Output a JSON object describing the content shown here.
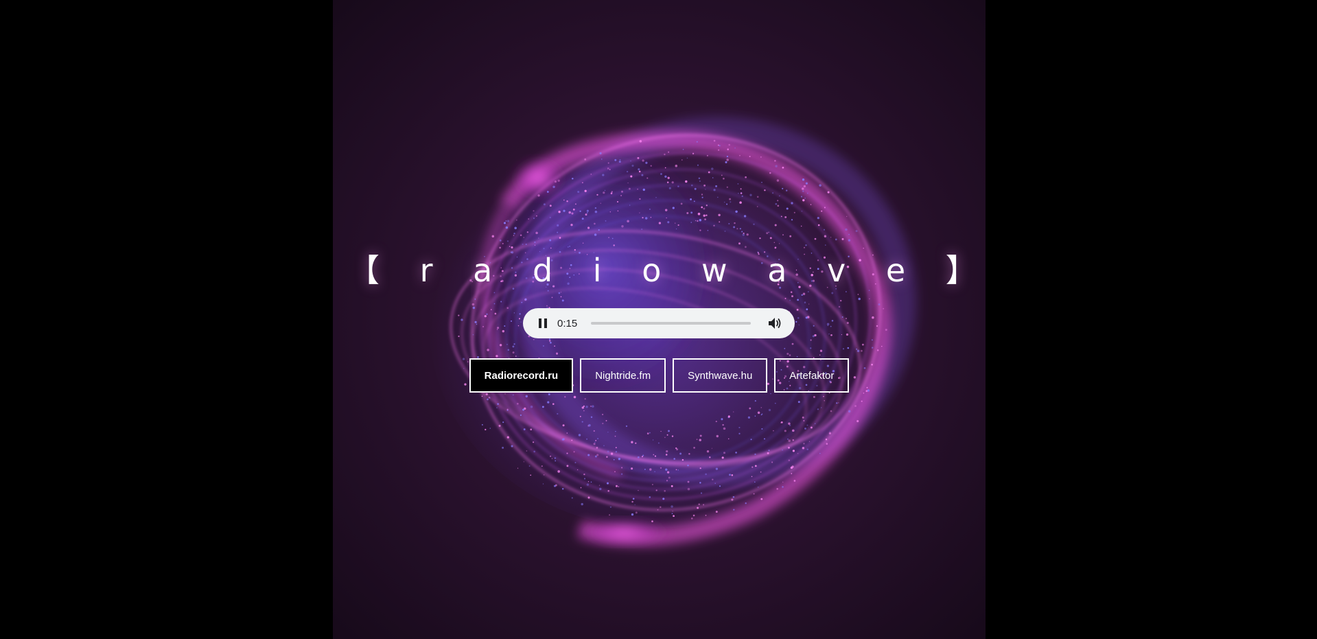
{
  "app": {
    "title": "【 r a d i o w a v e 】"
  },
  "player": {
    "state": "playing",
    "time": "0:15",
    "progress": 0,
    "pause_icon": "pause-icon",
    "volume_icon": "volume-icon"
  },
  "stations": [
    {
      "label": "Radiorecord.ru",
      "active": true
    },
    {
      "label": "Nightride.fm",
      "active": false
    },
    {
      "label": "Synthwave.hu",
      "active": false
    },
    {
      "label": "Artefaktor",
      "active": false
    }
  ],
  "colors": {
    "page_bg": "#000000",
    "stage_bg": "#2c1230",
    "accent_pink": "#ff5cf0",
    "accent_violet": "#6a4cff",
    "player_bg": "#f1f3f4",
    "text": "#ffffff"
  }
}
